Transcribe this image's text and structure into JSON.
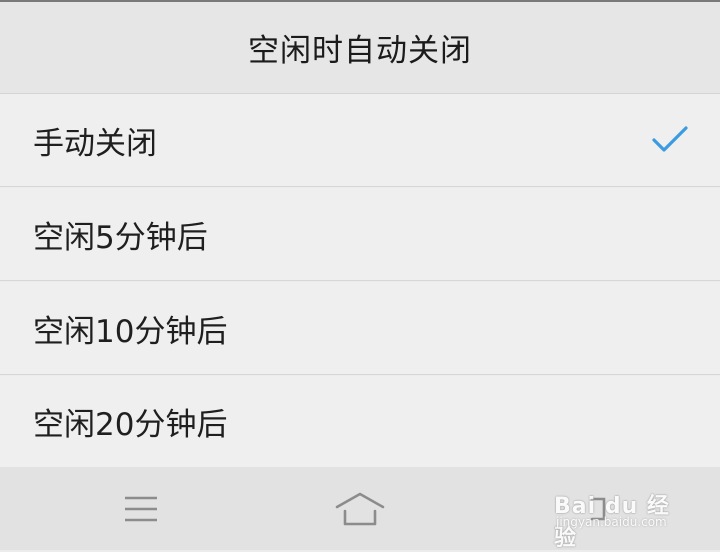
{
  "dialog": {
    "title": "空闲时自动关闭"
  },
  "options": [
    {
      "label": "手动关闭",
      "selected": true
    },
    {
      "label": "空闲5分钟后",
      "selected": false
    },
    {
      "label": "空闲10分钟后",
      "selected": false
    },
    {
      "label": "空闲20分钟后",
      "selected": false
    }
  ],
  "navbar": {
    "buttons": [
      "menu-icon",
      "home-icon",
      "back-icon"
    ]
  },
  "watermark": {
    "logo": "Bai du 经验",
    "url": "jingyan.baidu.com"
  },
  "colors": {
    "accent": "#3a9be0",
    "header_bg": "#e6e6e6",
    "row_bg": "#efefef",
    "navbar_bg": "#e2e2e2"
  }
}
